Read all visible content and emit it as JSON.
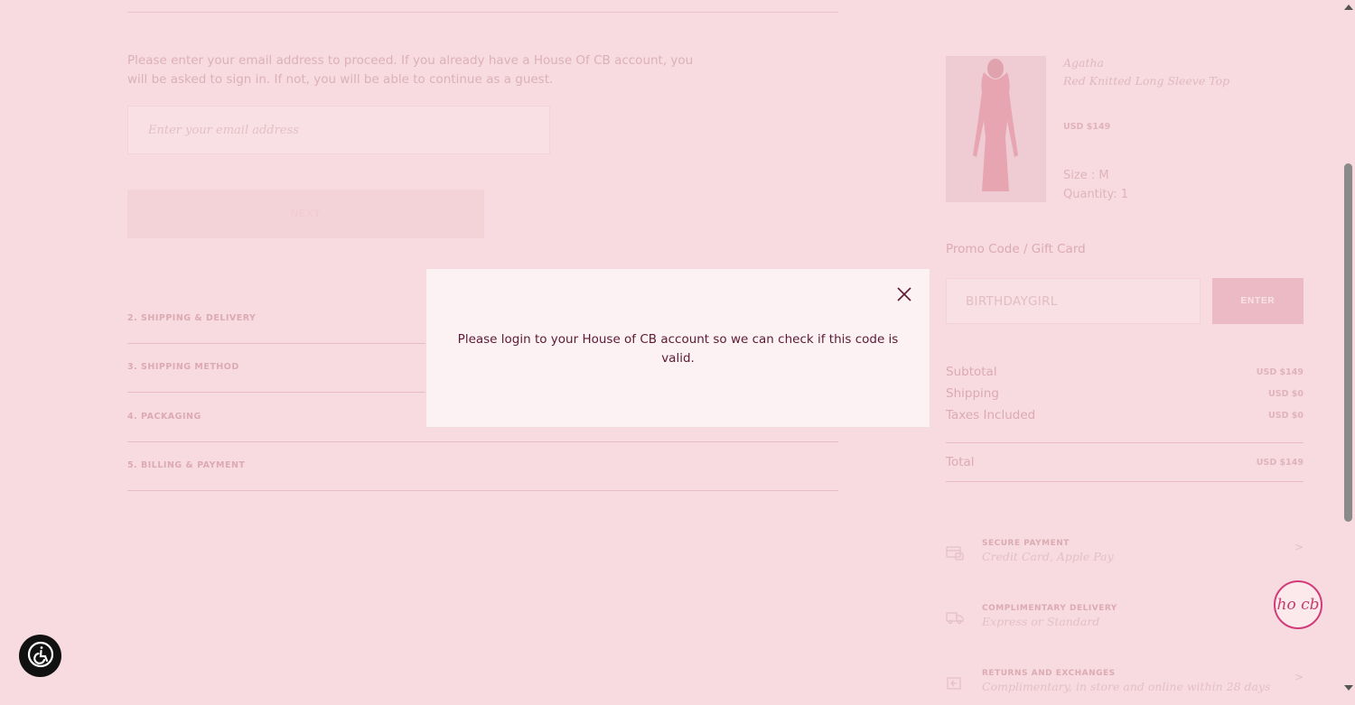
{
  "checkout": {
    "intro_text": "Please enter your email address to proceed. If you already have a House Of CB account, you will be asked to sign in. If not, you will be able to continue as a guest.",
    "email_placeholder": "Enter your email address",
    "next_label": "NEXT",
    "steps": [
      {
        "label": "2. SHIPPING & DELIVERY"
      },
      {
        "label": "3. SHIPPING METHOD"
      },
      {
        "label": "4. PACKAGING"
      },
      {
        "label": "5. BILLING & PAYMENT"
      }
    ]
  },
  "order": {
    "product": {
      "name_line1": "Agatha",
      "name_line2": "Red Knitted Long Sleeve Top",
      "price": "USD $149",
      "size": "Size : M",
      "quantity": "Quantity: 1"
    },
    "promo_label": "Promo Code / Gift Card",
    "promo_value": "BIRTHDAYGIRL",
    "enter_label": "ENTER",
    "summary": [
      {
        "label": "Subtotal",
        "value": "USD $149"
      },
      {
        "label": "Shipping",
        "value": "USD $0"
      },
      {
        "label": "Taxes Included",
        "value": "USD $0"
      }
    ],
    "total": {
      "label": "Total",
      "value": "USD $149"
    },
    "perks": [
      {
        "title": "SECURE PAYMENT",
        "subtitle": "Credit Card, Apple Pay",
        "icon": "card-lock-icon",
        "arrow": ">"
      },
      {
        "title": "COMPLIMENTARY DELIVERY",
        "subtitle": "Express or Standard",
        "icon": "truck-icon",
        "arrow": ""
      },
      {
        "title": "RETURNS AND EXCHANGES",
        "subtitle": "Complimentary, in store and online within 28 days",
        "icon": "return-box-icon",
        "arrow": ">"
      }
    ]
  },
  "modal": {
    "message": "Please login to your House of CB account so we can check if this code is valid.",
    "close_icon": "close-icon"
  },
  "chat_widget": {
    "label": "ho cb"
  },
  "colors": {
    "page_bg": "#f7dbe0",
    "modal_bg": "#fcf1f3",
    "modal_text": "#5c1a35",
    "brand_pink": "#d23a78"
  }
}
